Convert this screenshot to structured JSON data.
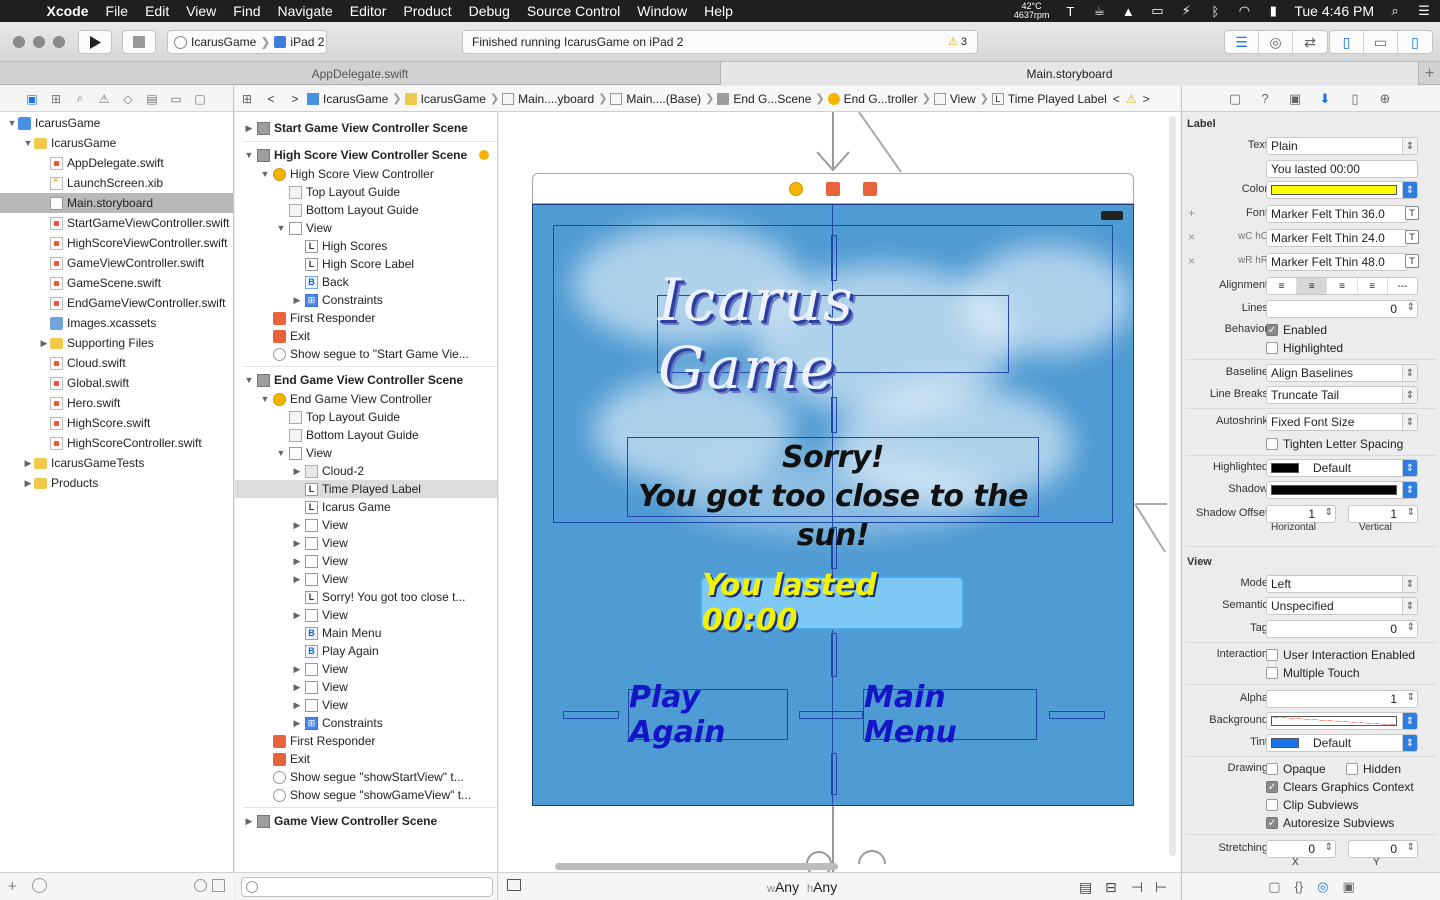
{
  "menubar": {
    "app": "Xcode",
    "items": [
      "File",
      "Edit",
      "View",
      "Find",
      "Navigate",
      "Editor",
      "Product",
      "Debug",
      "Source Control",
      "Window",
      "Help"
    ],
    "temp": "42°C",
    "rpm": "4637rpm",
    "clock": "Tue 4:46 PM"
  },
  "toolbar": {
    "scheme": "IcarusGame",
    "device": "iPad 2",
    "status": "Finished running IcarusGame on iPad 2",
    "warnings": "3"
  },
  "tabs": [
    "AppDelegate.swift",
    "Main.storyboard"
  ],
  "navigator": {
    "items": [
      {
        "label": "IcarusGame",
        "icon": "project-icon",
        "level": 0,
        "disclosure": "▼"
      },
      {
        "label": "IcarusGame",
        "icon": "folder-icon",
        "level": 1,
        "disclosure": "▼"
      },
      {
        "label": "AppDelegate.swift",
        "icon": "swift-file-icon",
        "level": 2,
        "disclosure": ""
      },
      {
        "label": "LaunchScreen.xib",
        "icon": "xib-file-icon",
        "level": 2,
        "disclosure": ""
      },
      {
        "label": "Main.storyboard",
        "icon": "storyboard-file-icon",
        "level": 2,
        "disclosure": "",
        "selected": true
      },
      {
        "label": "StartGameViewController.swift",
        "icon": "swift-file-icon",
        "level": 2,
        "disclosure": ""
      },
      {
        "label": "HighScoreViewController.swift",
        "icon": "swift-file-icon",
        "level": 2,
        "disclosure": ""
      },
      {
        "label": "GameViewController.swift",
        "icon": "swift-file-icon",
        "level": 2,
        "disclosure": ""
      },
      {
        "label": "GameScene.swift",
        "icon": "swift-file-icon",
        "level": 2,
        "disclosure": ""
      },
      {
        "label": "EndGameViewController.swift",
        "icon": "swift-file-icon",
        "level": 2,
        "disclosure": ""
      },
      {
        "label": "Images.xcassets",
        "icon": "assets-icon",
        "level": 2,
        "disclosure": ""
      },
      {
        "label": "Supporting Files",
        "icon": "folder-icon",
        "level": 2,
        "disclosure": "▶"
      },
      {
        "label": "Cloud.swift",
        "icon": "swift-file-icon",
        "level": 2,
        "disclosure": ""
      },
      {
        "label": "Global.swift",
        "icon": "swift-file-icon",
        "level": 2,
        "disclosure": ""
      },
      {
        "label": "Hero.swift",
        "icon": "swift-file-icon",
        "level": 2,
        "disclosure": ""
      },
      {
        "label": "HighScore.swift",
        "icon": "swift-file-icon",
        "level": 2,
        "disclosure": ""
      },
      {
        "label": "HighScoreController.swift",
        "icon": "swift-file-icon",
        "level": 2,
        "disclosure": ""
      },
      {
        "label": "IcarusGameTests",
        "icon": "folder-icon",
        "level": 1,
        "disclosure": "▶"
      },
      {
        "label": "Products",
        "icon": "folder-icon",
        "level": 1,
        "disclosure": "▶"
      }
    ]
  },
  "jumpbar": [
    "IcarusGame",
    "IcarusGame",
    "Main....yboard",
    "Main....(Base)",
    "End G...Scene",
    "End G...troller",
    "View",
    "Time Played Label"
  ],
  "outline": [
    {
      "label": "Start Game View Controller Scene",
      "type": "scene",
      "level": 0,
      "disc": "▶"
    },
    {
      "label": "High Score View Controller Scene",
      "type": "scene",
      "level": 0,
      "disc": "▼",
      "gap": true
    },
    {
      "label": "High Score View Controller",
      "type": "vc",
      "level": 1,
      "disc": "▼"
    },
    {
      "label": "Top Layout Guide",
      "type": "guide",
      "level": 2,
      "disc": ""
    },
    {
      "label": "Bottom Layout Guide",
      "type": "guide",
      "level": 2,
      "disc": ""
    },
    {
      "label": "View",
      "type": "view",
      "level": 2,
      "disc": "▼"
    },
    {
      "label": "High Scores",
      "type": "label",
      "level": 3,
      "disc": ""
    },
    {
      "label": "High Score Label",
      "type": "label",
      "level": 3,
      "disc": ""
    },
    {
      "label": "Back",
      "type": "button",
      "level": 3,
      "disc": ""
    },
    {
      "label": "Constraints",
      "type": "constraints",
      "level": 3,
      "disc": "▶"
    },
    {
      "label": "First Responder",
      "type": "responder",
      "level": 1,
      "disc": ""
    },
    {
      "label": "Exit",
      "type": "exit",
      "level": 1,
      "disc": ""
    },
    {
      "label": "Show segue to \"Start Game Vie...",
      "type": "segue",
      "level": 1,
      "disc": ""
    },
    {
      "label": "End Game View Controller Scene",
      "type": "scene",
      "level": 0,
      "disc": "▼",
      "gap": true
    },
    {
      "label": "End Game View Controller",
      "type": "vc",
      "level": 1,
      "disc": "▼"
    },
    {
      "label": "Top Layout Guide",
      "type": "guide",
      "level": 2,
      "disc": ""
    },
    {
      "label": "Bottom Layout Guide",
      "type": "guide",
      "level": 2,
      "disc": ""
    },
    {
      "label": "View",
      "type": "view",
      "level": 2,
      "disc": "▼"
    },
    {
      "label": "Cloud-2",
      "type": "image",
      "level": 3,
      "disc": "▶"
    },
    {
      "label": "Time Played Label",
      "type": "label",
      "level": 3,
      "disc": "",
      "selected": true
    },
    {
      "label": "Icarus Game",
      "type": "label",
      "level": 3,
      "disc": ""
    },
    {
      "label": "View",
      "type": "view",
      "level": 3,
      "disc": "▶"
    },
    {
      "label": "View",
      "type": "view",
      "level": 3,
      "disc": "▶"
    },
    {
      "label": "View",
      "type": "view",
      "level": 3,
      "disc": "▶"
    },
    {
      "label": "View",
      "type": "view",
      "level": 3,
      "disc": "▶"
    },
    {
      "label": "Sorry! You got too close t...",
      "type": "label",
      "level": 3,
      "disc": ""
    },
    {
      "label": "View",
      "type": "view",
      "level": 3,
      "disc": "▶"
    },
    {
      "label": "Main Menu",
      "type": "button",
      "level": 3,
      "disc": ""
    },
    {
      "label": "Play Again",
      "type": "button",
      "level": 3,
      "disc": ""
    },
    {
      "label": "View",
      "type": "view",
      "level": 3,
      "disc": "▶"
    },
    {
      "label": "View",
      "type": "view",
      "level": 3,
      "disc": "▶"
    },
    {
      "label": "View",
      "type": "view",
      "level": 3,
      "disc": "▶"
    },
    {
      "label": "Constraints",
      "type": "constraints",
      "level": 3,
      "disc": "▶"
    },
    {
      "label": "First Responder",
      "type": "responder",
      "level": 1,
      "disc": ""
    },
    {
      "label": "Exit",
      "type": "exit",
      "level": 1,
      "disc": ""
    },
    {
      "label": "Show segue \"showStartView\" t...",
      "type": "segue",
      "level": 1,
      "disc": ""
    },
    {
      "label": "Show segue \"showGameView\" t...",
      "type": "segue",
      "level": 1,
      "disc": ""
    },
    {
      "label": "Game View Controller Scene",
      "type": "scene",
      "level": 0,
      "disc": "▶",
      "gap": true
    }
  ],
  "canvas": {
    "title": "Icarus Game",
    "sorry_line1": "Sorry!",
    "sorry_line2": "You got too close to the sun!",
    "lasted": "You lasted 00:00",
    "play_again": "Play Again",
    "main_menu": "Main Menu",
    "size_w": "Any",
    "size_h": "Any",
    "size_w_prefix": "w",
    "size_h_prefix": "h",
    "colors": {
      "sky": "#4f9bd3",
      "title_text": "#eef2ff",
      "time_text": "#f2f204",
      "button_text": "#1515c8"
    }
  },
  "inspector": {
    "label_section": "Label",
    "text_label": "Text",
    "text_type": "Plain",
    "text_value": "You lasted 00:00",
    "color_label": "Color",
    "color_value": "#ffff00",
    "font_label": "Font",
    "font": "Marker Felt Thin 36.0",
    "font_wc_label": "wC hC",
    "font_wc": "Marker Felt Thin 24.0",
    "font_wr_label": "wR hR",
    "font_wr": "Marker Felt Thin 48.0",
    "alignment_label": "Alignment",
    "lines_label": "Lines",
    "lines": "0",
    "behavior_label": "Behavior",
    "enabled": "Enabled",
    "highlighted_chk": "Highlighted",
    "baseline_label": "Baseline",
    "baseline": "Align Baselines",
    "linebreaks_label": "Line Breaks",
    "linebreaks": "Truncate Tail",
    "autoshrink_label": "Autoshrink",
    "autoshrink": "Fixed Font Size",
    "tighten": "Tighten Letter Spacing",
    "highlighted_label": "Highlighted",
    "highlighted": "Default",
    "shadow_label": "Shadow",
    "shadow_offset_label": "Shadow Offset",
    "shadow_h": "1",
    "shadow_v": "1",
    "horizontal": "Horizontal",
    "vertical": "Vertical",
    "view_section": "View",
    "mode_label": "Mode",
    "mode": "Left",
    "semantic_label": "Semantic",
    "semantic": "Unspecified",
    "tag_label": "Tag",
    "tag": "0",
    "interaction_label": "Interaction",
    "user_interaction": "User Interaction Enabled",
    "multiple_touch": "Multiple Touch",
    "alpha_label": "Alpha",
    "alpha": "1",
    "background_label": "Background",
    "tint_label": "Tint",
    "tint": "Default",
    "drawing_label": "Drawing",
    "opaque": "Opaque",
    "hidden": "Hidden",
    "clears": "Clears Graphics Context",
    "clip": "Clip Subviews",
    "autoresize": "Autoresize Subviews",
    "stretching_label": "Stretching",
    "stretch_x": "0",
    "stretch_y": "0",
    "x": "X",
    "y": "Y"
  }
}
